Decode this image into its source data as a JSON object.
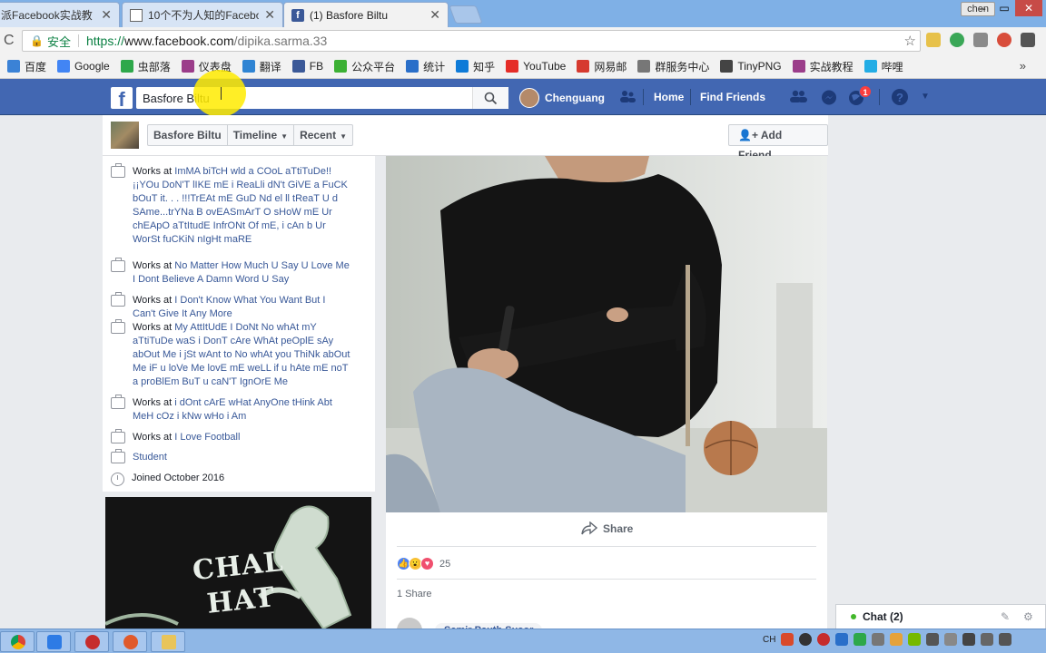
{
  "browser": {
    "tabs": [
      {
        "title": "派Facebook实战教",
        "favicon": "generic"
      },
      {
        "title": "10个不为人知的Facebo",
        "favicon": "doc-icon"
      },
      {
        "title": "(1) Basfore Biltu",
        "favicon": "facebook-icon",
        "active": true
      }
    ],
    "profile": "chen",
    "security_label": "安全",
    "url": {
      "protocol": "https://",
      "host": "www.facebook.com",
      "path": "/dipika.sarma.33"
    }
  },
  "bookmarks": [
    {
      "label": "百度",
      "color": "#3b82d6"
    },
    {
      "label": "Google",
      "color": "#4285f4"
    },
    {
      "label": "虫部落",
      "color": "#2ea84a"
    },
    {
      "label": "仪表盘",
      "color": "#9b3d8a"
    },
    {
      "label": "翻译",
      "color": "#2f84d3"
    },
    {
      "label": "FB",
      "color": "#3b5998"
    },
    {
      "label": "公众平台",
      "color": "#3cb034"
    },
    {
      "label": "统计",
      "color": "#2a6fc9"
    },
    {
      "label": "知乎",
      "color": "#0e7bd8"
    },
    {
      "label": "YouTube",
      "color": "#e52d27"
    },
    {
      "label": "网易邮",
      "color": "#d63a2f"
    },
    {
      "label": "群服务中心",
      "color": "#777777"
    },
    {
      "label": "TinyPNG",
      "color": "#444444"
    },
    {
      "label": "实战教程",
      "color": "#9b3d8a"
    },
    {
      "label": "哔哩",
      "color": "#23ade5"
    }
  ],
  "fb_header": {
    "search_value": "Basfore Biltu",
    "user_name": "Chenguang",
    "home": "Home",
    "find_friends": "Find Friends",
    "notification_count": "1"
  },
  "timeline": {
    "profile_name": "Basfore Biltu",
    "timeline_label": "Timeline",
    "recent_label": "Recent",
    "add_friend": "Add Friend"
  },
  "intro": {
    "works_prefix": "Works at ",
    "items": [
      {
        "text": "ImMA biTcH wld a COoL aTtiTuDe!! ¡¡YOu DoN'T lIKE mE i ReaLli dN't GiVE a FuCK bOuT it. . . !!!TrEAt mE GuD Nd el ll tReaT U d SAme...trYNa B ovEASmArT O sHoW mE Ur chEApO aTtItudE InfrONt Of mE, i cAn b Ur WorSt fuCKiN nIgHt maRE"
      },
      {
        "text": "No Matter How Much U Say U Love Me I Dont Believe A Damn Word U Say"
      },
      {
        "text": "I Don't Know What You Want But I Can't Give It Any More"
      },
      {
        "text": "My AttItUdE I DoNt No whAt mY aTtiTuDe waS i DonT cAre WhAt peOplE sAy abOut Me i jSt wAnt to No whAt you ThiNk abOut Me iF u loVe Me lovE mE weLL if u hAte mE noT a proBlEm BuT u caN'T IgnOrE Me"
      },
      {
        "text": "i dOnt cArE wHat AnyOne tHink Abt MeH cOz i kNw wHo i Am"
      },
      {
        "text": "I Love Football"
      }
    ],
    "student": "Student",
    "joined": "Joined October 2016"
  },
  "photo_tile_text": "CHAL\nHAT",
  "post": {
    "share_action": "Share",
    "reaction_count": "25",
    "shares": "1 Share",
    "commenter": "Samir Pauth Susor"
  },
  "chat": {
    "label": "Chat (2)"
  },
  "taskbar": {
    "tray_label": "CH"
  },
  "colors": {
    "fb_blue": "#4267b2",
    "link": "#385898",
    "bg": "#e9ebee"
  }
}
